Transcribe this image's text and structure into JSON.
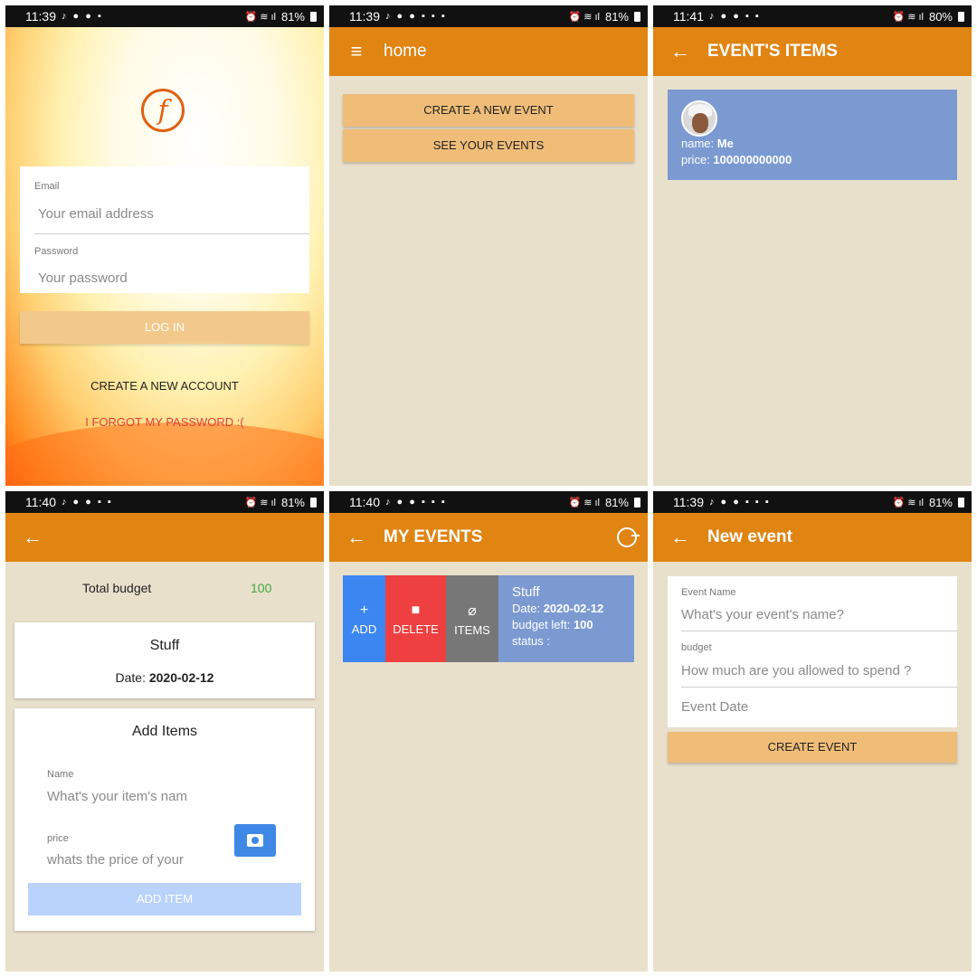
{
  "screens": {
    "login": {
      "status": {
        "time": "11:39",
        "battery": "81%"
      },
      "email_label": "Email",
      "email_placeholder": "Your email address",
      "password_label": "Password",
      "password_placeholder": "Your password",
      "login_button": "LOG IN",
      "create_account": "CREATE A NEW ACCOUNT",
      "forgot_password": "I FORGOT MY PASSWORD :("
    },
    "home": {
      "status": {
        "time": "11:39",
        "battery": "81%"
      },
      "title": "home",
      "create_event": "CREATE A NEW EVENT",
      "see_events": "SEE YOUR EVENTS"
    },
    "event_items": {
      "status": {
        "time": "11:41",
        "battery": "80%"
      },
      "title": "EVENT'S ITEMS",
      "item": {
        "name_label": "name:",
        "name": "Me",
        "price_label": "price:",
        "price": "100000000000"
      }
    },
    "budget": {
      "status": {
        "time": "11:40",
        "battery": "81%"
      },
      "total_budget_label": "Total budget",
      "total_budget_value": "100",
      "event_name": "Stuff",
      "date_label": "Date:",
      "date": "2020-02-12",
      "add_items_title": "Add Items",
      "name_label": "Name",
      "name_placeholder": "What's your item's nam",
      "price_label": "price",
      "price_placeholder": "whats the price of your",
      "add_item_button": "ADD ITEM"
    },
    "my_events": {
      "status": {
        "time": "11:40",
        "battery": "81%"
      },
      "title": "MY EVENTS",
      "actions": {
        "add": "ADD",
        "delete": "DELETE",
        "items": "ITEMS"
      },
      "event": {
        "name": "Stuff",
        "date_label": "Date:",
        "date": "2020-02-12",
        "budget_label": "budget left:",
        "budget": "100",
        "status_label": "status :"
      }
    },
    "new_event": {
      "status": {
        "time": "11:39",
        "battery": "81%"
      },
      "title": "New event",
      "event_name_label": "Event Name",
      "event_name_placeholder": "What's your event's name?",
      "budget_label": "budget",
      "budget_placeholder": "How much are you allowed to spend ?",
      "event_date_placeholder": "Event Date",
      "create_button": "CREATE EVENT"
    }
  },
  "colors": {
    "appbar": "#e08412",
    "background": "#e9e0cc",
    "card_blue": "#7b9ad2",
    "button_orange": "#efbd78"
  },
  "icons": [
    "menu-icon",
    "back-arrow-icon",
    "logout-icon",
    "camera-icon",
    "plus-icon",
    "trash-icon",
    "paperclip-icon",
    "app-logo"
  ]
}
